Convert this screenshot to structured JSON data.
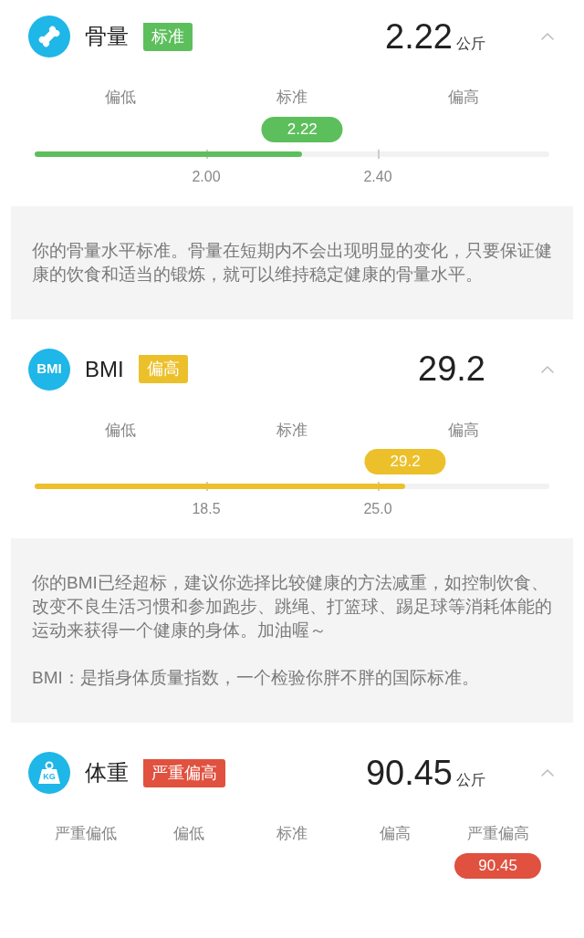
{
  "sections": [
    {
      "icon": {
        "kind": "bone"
      },
      "title": "骨量",
      "tag": {
        "label": "标准",
        "color": "#5cbf5c"
      },
      "value": "2.22",
      "unit": "公斤",
      "expanded": true,
      "scale_labels": [
        "偏低",
        "标准",
        "偏高"
      ],
      "reading": "2.22",
      "level": 0.52,
      "thresholds": [
        "2.00",
        "2.40"
      ],
      "note": [
        "你的骨量水平标准。骨量在短期内不会出现明显的变化，只要保证健康的饮食和适当的锻炼，就可以维持稳定健康的骨量水平。"
      ]
    },
    {
      "icon": {
        "kind": "text",
        "text": "BMI"
      },
      "title": "BMI",
      "tag": {
        "label": "偏高",
        "color": "#ecc02a"
      },
      "value": "29.2",
      "expanded": true,
      "scale_labels": [
        "偏低",
        "标准",
        "偏高"
      ],
      "reading": "29.2",
      "level": 0.72,
      "thresholds": [
        "18.5",
        "25.0"
      ],
      "note": [
        "你的BMI已经超标，建议你选择比较健康的方法减重，如控制饮食、改变不良生活习惯和参加跑步、跳绳、打篮球、踢足球等消耗体能的运动来获得一个健康的身体。加油喔～",
        "BMI：是指身体质量指数，一个检验你胖不胖的国际标准。"
      ]
    },
    {
      "icon": {
        "kind": "weight",
        "text": "KG"
      },
      "title": "体重",
      "tag": {
        "label": "严重偏高",
        "color": "#e0513f"
      },
      "value": "90.45",
      "unit": "公斤",
      "expanded": true,
      "scale_labels": [
        {
          "label": "严重偏低",
          "selected": false
        },
        {
          "label": "偏低",
          "selected": false
        },
        {
          "label": "标准",
          "selected": false
        },
        {
          "label": "偏高",
          "selected": false
        },
        {
          "label": "严重偏高",
          "selected": true
        }
      ],
      "reading": "90.45"
    }
  ]
}
